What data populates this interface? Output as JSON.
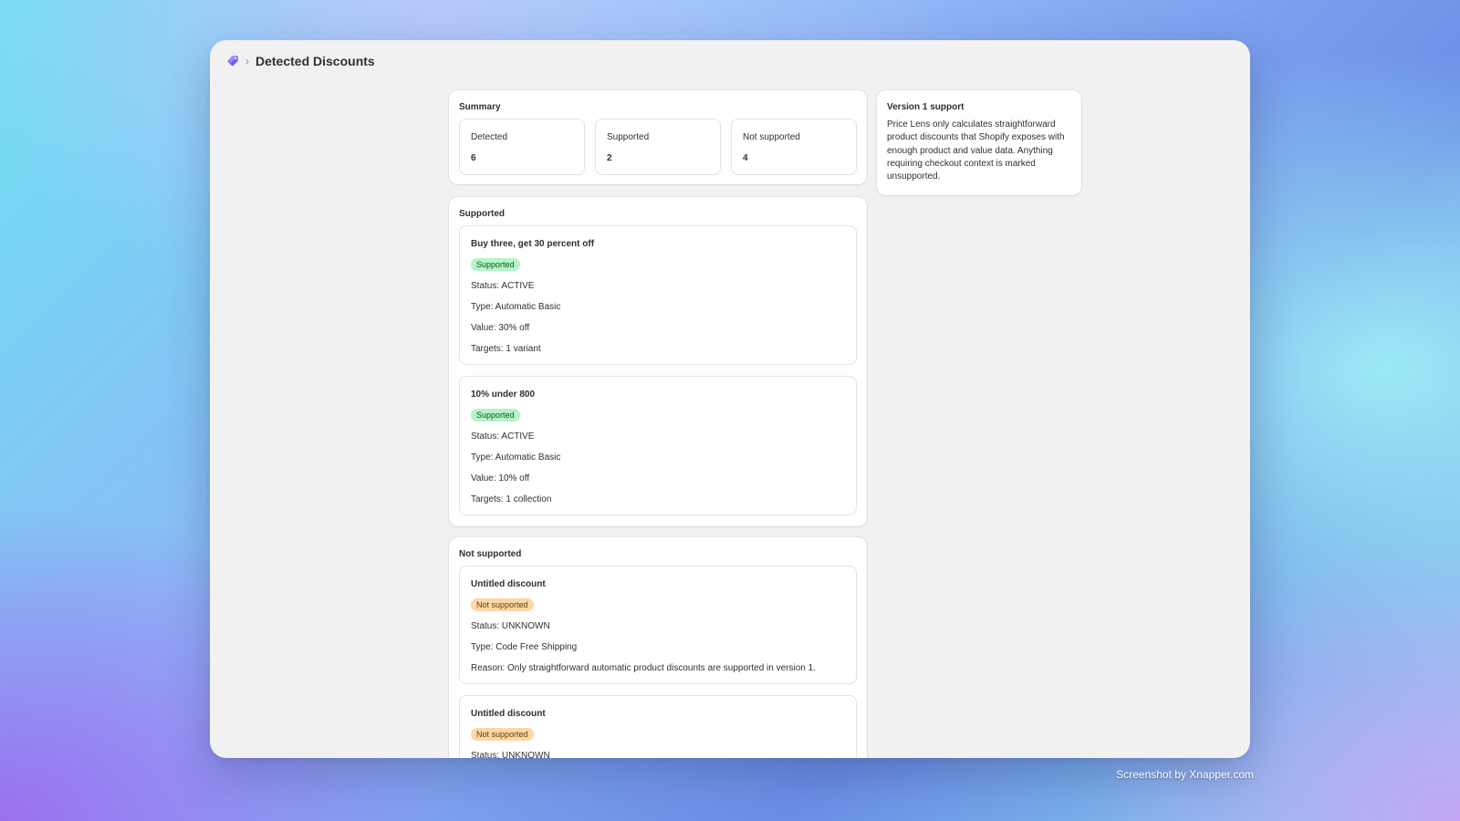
{
  "page": {
    "title": "Detected Discounts"
  },
  "summary": {
    "title": "Summary",
    "stats": [
      {
        "label": "Detected",
        "value": "6"
      },
      {
        "label": "Supported",
        "value": "2"
      },
      {
        "label": "Not supported",
        "value": "4"
      }
    ]
  },
  "supported": {
    "title": "Supported",
    "items": [
      {
        "name": "Buy three, get 30 percent off",
        "badge": "Supported",
        "status": "Status: ACTIVE",
        "type": "Type: Automatic Basic",
        "value": "Value: 30% off",
        "targets": "Targets: 1 variant"
      },
      {
        "name": "10% under 800",
        "badge": "Supported",
        "status": "Status: ACTIVE",
        "type": "Type: Automatic Basic",
        "value": "Value: 10% off",
        "targets": "Targets: 1 collection"
      }
    ]
  },
  "not_supported": {
    "title": "Not supported",
    "items": [
      {
        "name": "Untitled discount",
        "badge": "Not supported",
        "status": "Status: UNKNOWN",
        "type": "Type: Code Free Shipping",
        "reason": "Reason: Only straightforward automatic product discounts are supported in version 1."
      },
      {
        "name": "Untitled discount",
        "badge": "Not supported",
        "status": "Status: UNKNOWN"
      }
    ]
  },
  "side_card": {
    "title": "Version 1 support",
    "text": "Price Lens only calculates straightforward product discounts that Shopify exposes with enough product and value data. Anything requiring checkout context is marked unsupported."
  },
  "watermark": "Screenshot by Xnapper.com",
  "colors": {
    "supported_badge": "#b4f5c4",
    "not_supported_badge": "#ffd6a4",
    "app_icon": "#7b5cf0"
  },
  "icons": {
    "app": "tag-icon",
    "breadcrumb": "chevron-right-icon"
  }
}
